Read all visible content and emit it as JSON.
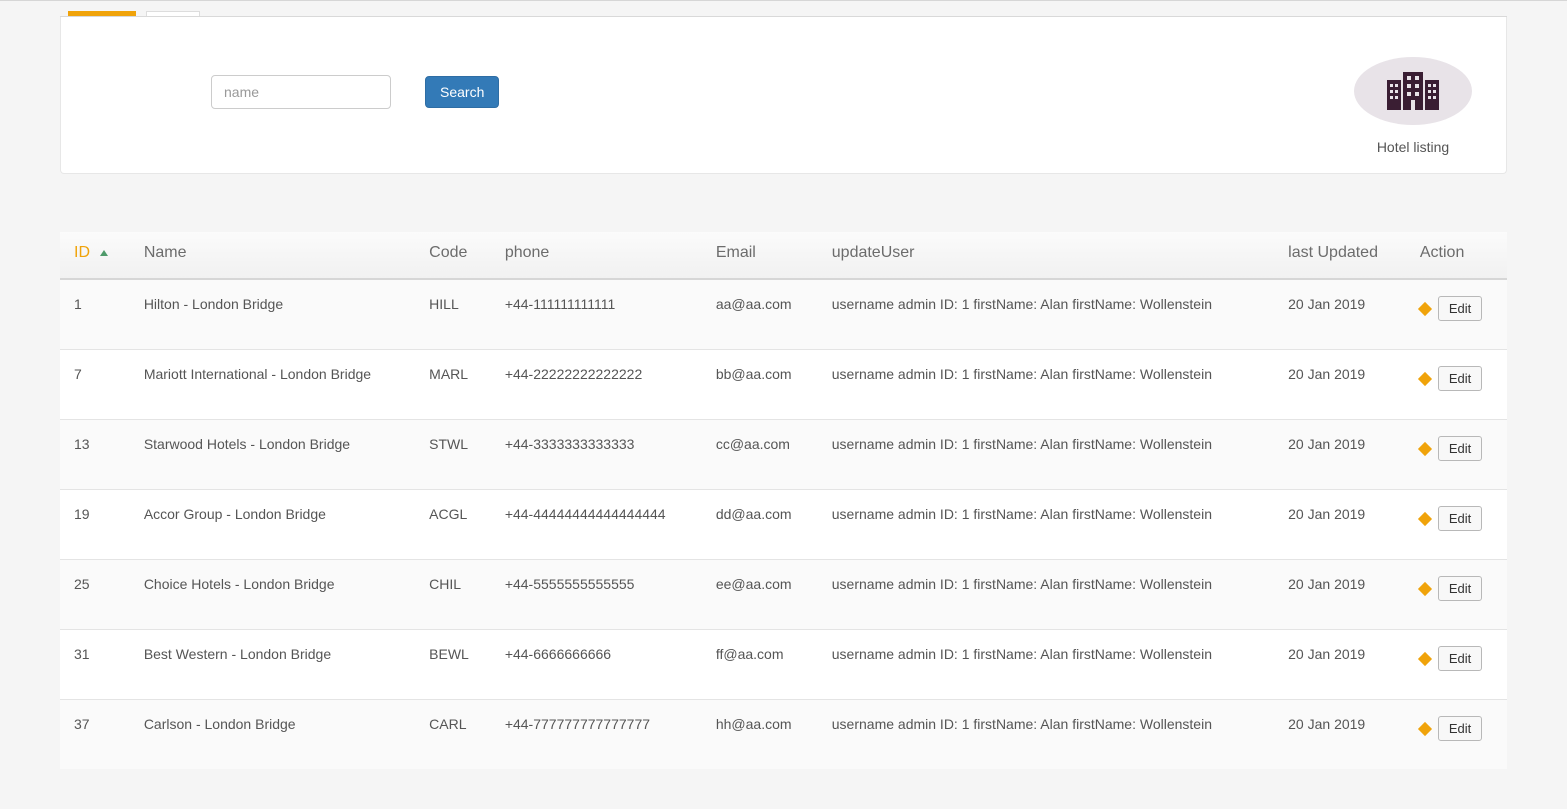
{
  "search": {
    "placeholder": "name",
    "button": "Search"
  },
  "logo": {
    "caption": "Hotel listing"
  },
  "table": {
    "headers": {
      "id": "ID",
      "name": "Name",
      "code": "Code",
      "phone": "phone",
      "email": "Email",
      "updateUser": "updateUser",
      "lastUpdated": "last Updated",
      "action": "Action"
    },
    "editLabel": "Edit",
    "rows": [
      {
        "id": "1",
        "name": "Hilton - London Bridge",
        "code": "HILL",
        "phone": "+44-111111111111",
        "email": "aa@aa.com",
        "updateUser": "username admin ID: 1 firstName: Alan firstName: Wollenstein",
        "lastUpdated": "20 Jan 2019"
      },
      {
        "id": "7",
        "name": "Mariott International - London Bridge",
        "code": "MARL",
        "phone": "+44-22222222222222",
        "email": "bb@aa.com",
        "updateUser": "username admin ID: 1 firstName: Alan firstName: Wollenstein",
        "lastUpdated": "20 Jan 2019"
      },
      {
        "id": "13",
        "name": "Starwood Hotels - London Bridge",
        "code": "STWL",
        "phone": "+44-3333333333333",
        "email": "cc@aa.com",
        "updateUser": "username admin ID: 1 firstName: Alan firstName: Wollenstein",
        "lastUpdated": "20 Jan 2019"
      },
      {
        "id": "19",
        "name": "Accor Group - London Bridge",
        "code": "ACGL",
        "phone": "+44-44444444444444444",
        "email": "dd@aa.com",
        "updateUser": "username admin ID: 1 firstName: Alan firstName: Wollenstein",
        "lastUpdated": "20 Jan 2019"
      },
      {
        "id": "25",
        "name": "Choice Hotels - London Bridge",
        "code": "CHIL",
        "phone": "+44-5555555555555",
        "email": "ee@aa.com",
        "updateUser": "username admin ID: 1 firstName: Alan firstName: Wollenstein",
        "lastUpdated": "20 Jan 2019"
      },
      {
        "id": "31",
        "name": "Best Western - London Bridge",
        "code": "BEWL",
        "phone": "+44-6666666666",
        "email": "ff@aa.com",
        "updateUser": "username admin ID: 1 firstName: Alan firstName: Wollenstein",
        "lastUpdated": "20 Jan 2019"
      },
      {
        "id": "37",
        "name": "Carlson - London Bridge",
        "code": "CARL",
        "phone": "+44-777777777777777",
        "email": "hh@aa.com",
        "updateUser": "username admin ID: 1 firstName: Alan firstName: Wollenstein",
        "lastUpdated": "20 Jan 2019"
      }
    ]
  }
}
